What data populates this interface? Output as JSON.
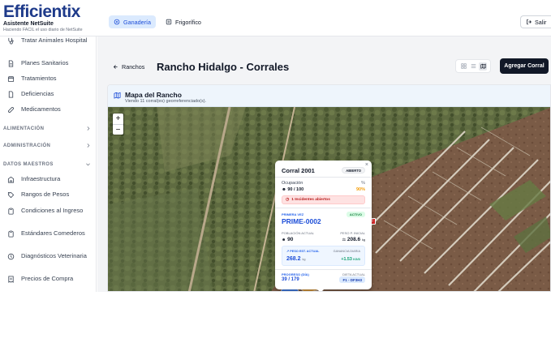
{
  "brand": {
    "logo": "Efficientix",
    "title": "Asistente NetSuite",
    "tagline": "Haciendo FACIL el uso diario de NetSuite"
  },
  "header": {
    "tabs": [
      {
        "label": "Ganadería",
        "icon": "cow-icon",
        "active": true
      },
      {
        "label": "Frigorífico",
        "icon": "factory-icon",
        "active": false
      }
    ],
    "logout_label": "Salir"
  },
  "sidebar": {
    "items_top": [
      {
        "label": "Tratar Animales Hospital",
        "icon": "stethoscope-icon"
      },
      {
        "label": "Planes Sanitarios",
        "icon": "document-icon"
      },
      {
        "label": "Tratamientos",
        "icon": "calendar-icon"
      },
      {
        "label": "Deficiencias",
        "icon": "file-icon"
      },
      {
        "label": "Medicamentos",
        "icon": "pill-icon"
      }
    ],
    "sections": [
      {
        "label": "ALIMENTACIÓN",
        "expanded": false
      },
      {
        "label": "ADMINISTRACIÓN",
        "expanded": false
      },
      {
        "label": "DATOS MAESTROS",
        "expanded": true
      }
    ],
    "items_master": [
      {
        "label": "Infraestructura",
        "icon": "building-icon"
      },
      {
        "label": "Rangos de Pesos",
        "icon": "tag-icon"
      },
      {
        "label": "Condiciones al Ingreso",
        "icon": "clipboard-icon"
      },
      {
        "label": "Estándares Comederos",
        "icon": "clipboard-icon"
      },
      {
        "label": "Diagnósticos Veterinaria",
        "icon": "activity-icon"
      },
      {
        "label": "Precios de Compra",
        "icon": "receipt-icon"
      }
    ]
  },
  "main": {
    "back_label": "Ranchos",
    "title": "Rancho Hidalgo - Corrales",
    "add_button": "Agregar Corral",
    "view_modes": [
      "grid",
      "list",
      "map"
    ],
    "active_view": "map"
  },
  "map": {
    "title": "Mapa del Rancho",
    "subtitle": "Viendo 11 corral(es) georreferenciado(s).",
    "zoom_in": "+",
    "zoom_out": "−",
    "alert_pin_label": "!"
  },
  "popup": {
    "title": "Corral 2001",
    "status_badge": "ABIERTO",
    "close": "×",
    "occupancy_label": "Ocupación",
    "percent_label": "%",
    "occupancy_value": "90 / 100",
    "occupancy_percent": "90%",
    "alert_text": "1 Incidentes abiertos",
    "primera_vez_label": "PRIMERA VEZ",
    "active_badge": "ACTIVO",
    "primera_vez_code": "PRIME-0002",
    "poblacion_label": "POBLACIÓN ACTUAL",
    "poblacion_value": "90",
    "peso_inicial_label": "PESO P. INICIAL",
    "peso_inicial_value": "208.6",
    "peso_inicial_unit": "kg",
    "peso_est_label": "PESO EST. ACTUAL",
    "peso_est_value": "268.2",
    "peso_est_unit": "kg",
    "ganancia_label": "GANANCIA DIARIA",
    "ganancia_value": "+1.53",
    "ganancia_unit": "KG/D",
    "progreso_label": "PROGRESO (DÍA)",
    "progreso_value": "39 / 179",
    "dieta_label": "DIETA ACTUAL",
    "dieta_value": "F1 - DF3H3"
  },
  "colors": {
    "accent": "#1d4ed8",
    "brand": "#1e3a8a",
    "primary_button": "#111827",
    "warning": "#f59e0b",
    "danger": "#dc2626",
    "success": "#15803d"
  }
}
